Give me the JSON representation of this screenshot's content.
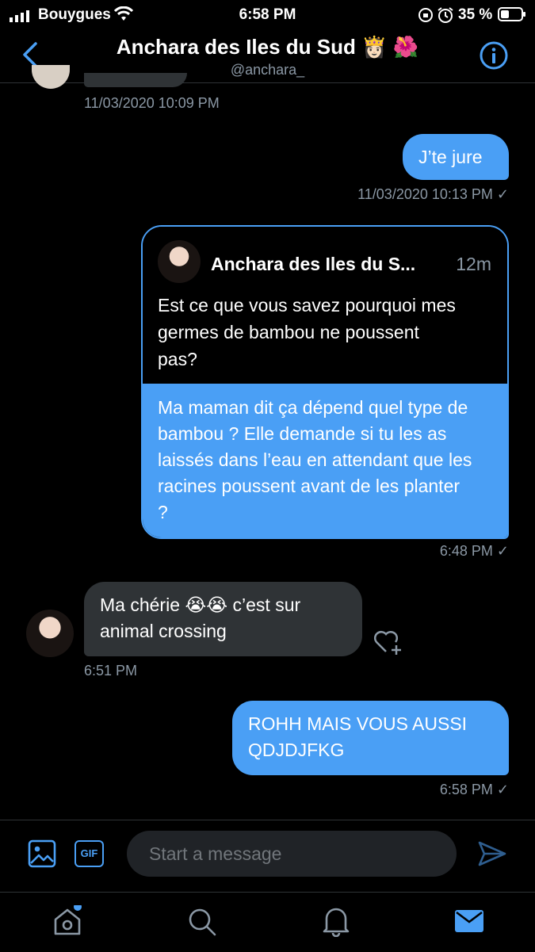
{
  "status_bar": {
    "carrier": "Bouygues",
    "time": "6:58 PM",
    "battery_text": "35 %"
  },
  "header": {
    "title": "Anchara des Iles du Sud 👸🏻 🌺",
    "handle": "@anchara_"
  },
  "messages": [
    {
      "direction": "in",
      "timestamp": "11/03/2020 10:09 PM"
    },
    {
      "direction": "out",
      "text": "J’te jure",
      "timestamp": "11/03/2020 10:13 PM ✓"
    },
    {
      "direction": "out",
      "quote": {
        "author": "Anchara des Iles du S...",
        "age": "12m",
        "text": "Est ce que vous savez pourquoi mes germes de bambou ne poussent pas?"
      },
      "text": "Ma maman dit ça dépend quel type de bambou ? Elle demande si tu les as laissés dans l’eau en attendant que les racines poussent avant de les planter ?",
      "timestamp": "6:48 PM ✓"
    },
    {
      "direction": "in",
      "text": "Ma chérie 😭😭 c’est sur animal crossing",
      "timestamp": "6:51 PM"
    },
    {
      "direction": "out",
      "text": "ROHH MAIS VOUS AUSSI QDJDJFKG",
      "timestamp": "6:58 PM ✓"
    }
  ],
  "composer": {
    "placeholder": "Start a message",
    "gif_label": "GIF"
  },
  "colors": {
    "accent": "#4a9ff5",
    "incoming_bubble": "#2f3336",
    "background": "#000000",
    "muted_text": "#8b98a5"
  }
}
